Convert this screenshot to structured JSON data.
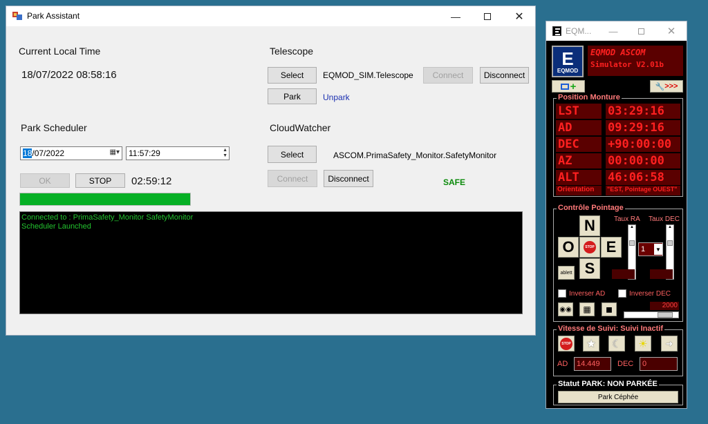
{
  "park_assistant": {
    "title": "Park Assistant",
    "current_time_label": "Current Local Time",
    "current_time_value": "18/07/2022 08:58:16",
    "scheduler_label": "Park Scheduler",
    "date_value_sel": "18",
    "date_value_rest": "/07/2022",
    "time_value": "11:57:29",
    "ok_label": "OK",
    "stop_label": "STOP",
    "countdown": "02:59:12",
    "progress": 1.0,
    "telescope_label": "Telescope",
    "select_label": "Select",
    "telescope_name": "EQMOD_SIM.Telescope",
    "connect_label": "Connect",
    "disconnect_label": "Disconnect",
    "park_label": "Park",
    "unpark_label": "Unpark",
    "cloudwatcher_label": "CloudWatcher",
    "cw_select_label": "Select",
    "cw_name": "ASCOM.PrimaSafety_Monitor.SafetyMonitor",
    "cw_connect_label": "Connect",
    "cw_disconnect_label": "Disconnect",
    "safe_status": "SAFE",
    "log_lines": [
      "Connected to : PrimaSafety_Monitor SafetyMonitor",
      "Scheduler Launched"
    ]
  },
  "eqmod": {
    "title": "EQM...",
    "logo_text": "EQMOD",
    "banner_line1": "EQMOD ASCOM",
    "banner_line2": "Simulator V2.01b",
    "position_title": "Position Monture",
    "rows": [
      {
        "label": "LST",
        "value": "03:29:16"
      },
      {
        "label": "AD",
        "value": "09:29:16"
      },
      {
        "label": "DEC",
        "value": "+90:00:00"
      },
      {
        "label": "AZ",
        "value": "00:00:00"
      },
      {
        "label": "ALT",
        "value": "46:06:58"
      }
    ],
    "orientation_label": "Orientation",
    "orientation_value": "\"EST, Pointage OUEST\"",
    "pointage_title": "Contrôle Pointage",
    "taux_ra": "Taux RA",
    "taux_dec": "Taux DEC",
    "n": "N",
    "s": "S",
    "e": "E",
    "o": "O",
    "stop_text": "STOP",
    "rate_value": "1",
    "tablet_label": "ablett",
    "inverser_ad": "Inverser AD",
    "inverser_dec": "Inverser DEC",
    "slider_value": "2000",
    "vitesse_title": "Vitesse de Suivi: Suivi Inactif",
    "ad_label": "AD",
    "ad_value": "14.449",
    "dec_label": "DEC",
    "dec_value": "0",
    "statut_title": "Statut PARK: NON PARKÉE",
    "park_button": "Park Céphée",
    "colors": {
      "led_bg": "#5a0000",
      "led_text": "#ff2020",
      "group_title": "#ff7a7a"
    }
  }
}
